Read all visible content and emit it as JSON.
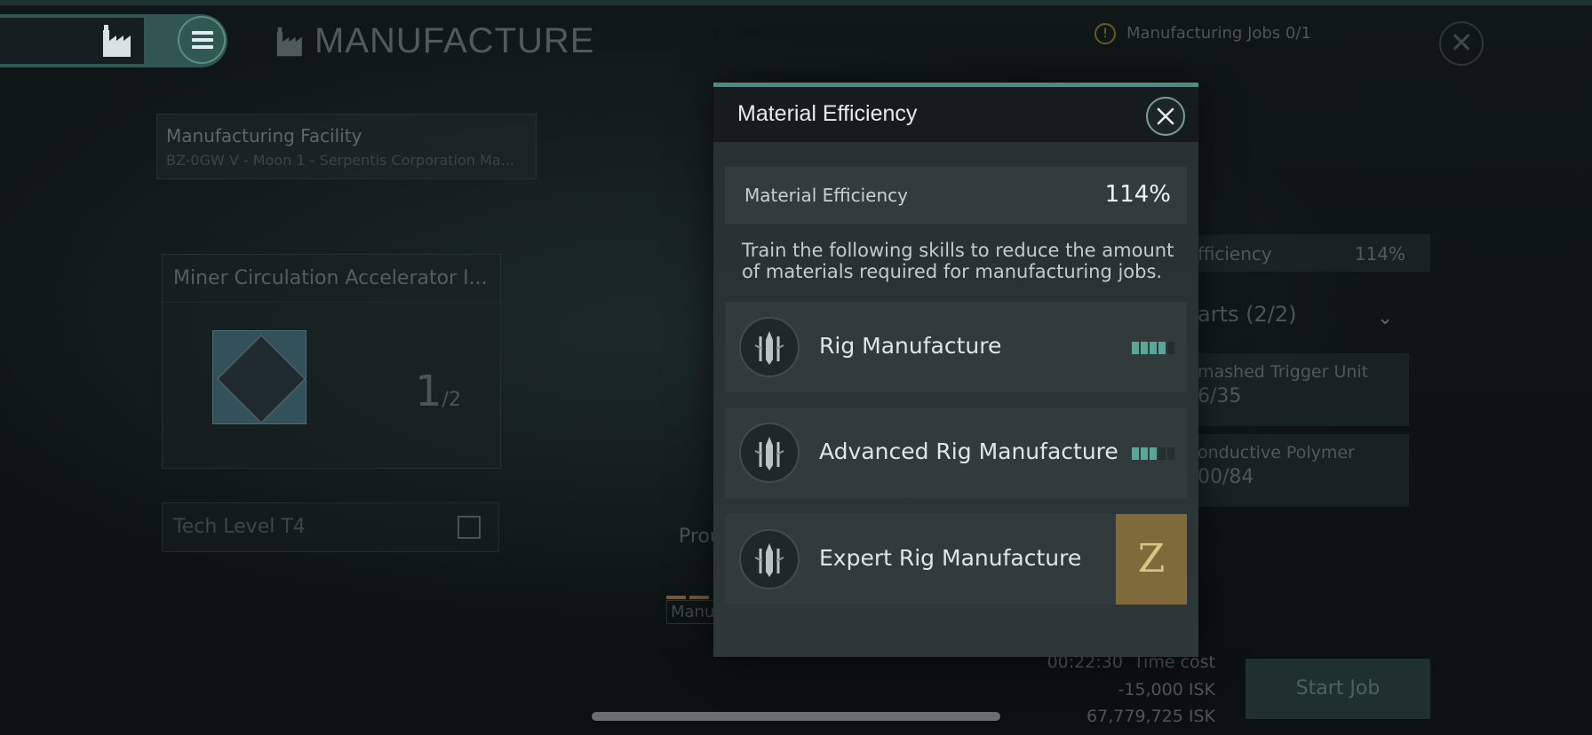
{
  "header": {
    "title": "MANUFACTURE",
    "jobs_status": "Manufacturing Jobs 0/1",
    "warning_glyph": "!",
    "close_glyph": "✕"
  },
  "facility": {
    "label": "Manufacturing Facility",
    "location": "BZ-0GW V - Moon 1 - Serpentis Corporation Ma..."
  },
  "blueprint": {
    "name": "Miner Circulation Accelerator I...",
    "count": "1",
    "total": "/2"
  },
  "tech_level": "Tech Level T4",
  "production_label": "Prou",
  "manufacture_tab": "Manu",
  "right_panel": {
    "efficiency_label": "fficiency",
    "efficiency_value": "114%",
    "parts_label": "arts (2/2)",
    "parts_chevron": "⌄",
    "items": [
      {
        "name": "mashed Trigger Unit",
        "qty": "6/35"
      },
      {
        "name": "onductive Polymer",
        "qty": "00/84"
      }
    ]
  },
  "cost": {
    "time": "00:22:30",
    "time_label": "Time cost",
    "isk_cost": "-15,000 ISK",
    "isk_balance": "67,779,725 ISK"
  },
  "start_button": "Start Job",
  "modal": {
    "title": "Material Efficiency",
    "efficiency_label": "Material Efficiency",
    "efficiency_value": "114%",
    "description": "Train the following skills to reduce the amount of materials required for manufacturing jobs.",
    "skills": [
      {
        "name": "Rig Manufacture",
        "level": 4,
        "max_level": 5
      },
      {
        "name": "Advanced Rig Manufacture",
        "level": 3,
        "max_level": 5
      },
      {
        "name": "Expert Rig Manufacture",
        "badge": "Z"
      }
    ]
  },
  "colors": {
    "accent": "#4b8b83",
    "level_on": "#5aa79a",
    "locked_badge": "#7e6a3a"
  }
}
